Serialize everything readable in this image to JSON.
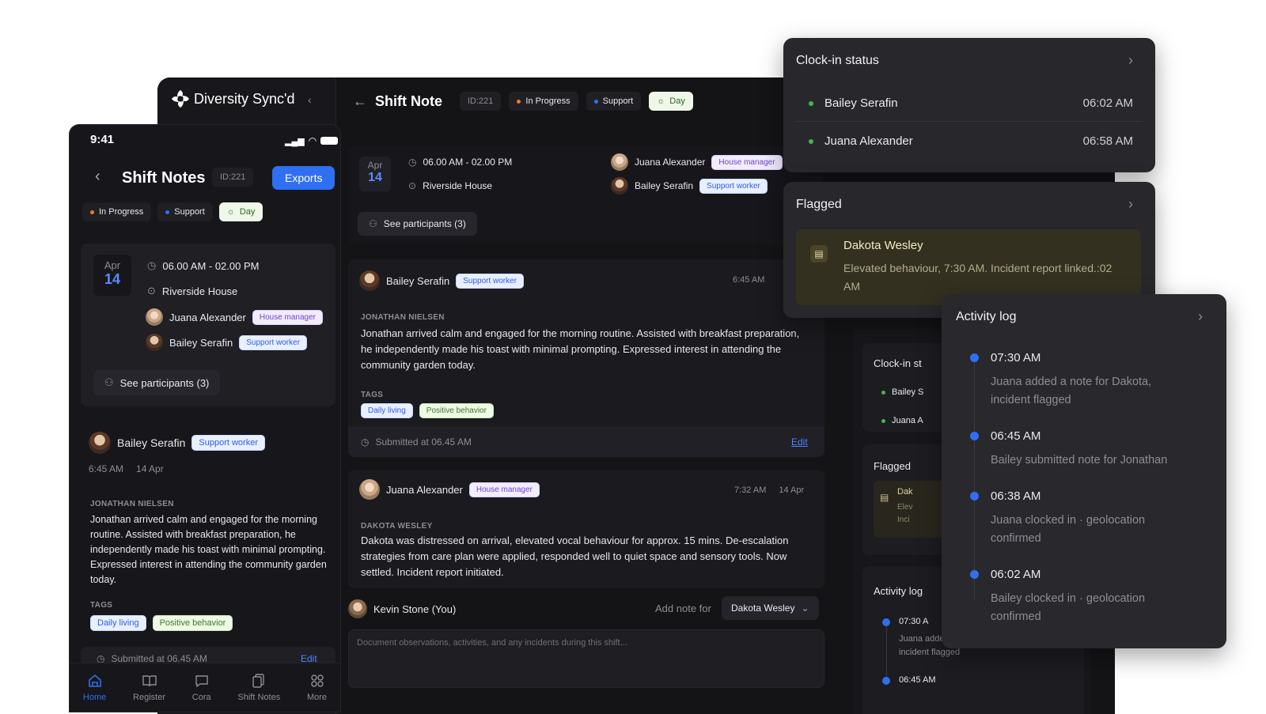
{
  "desktop": {
    "brand": "Diversity Sync'd",
    "header": {
      "title": "Shift Note",
      "id": "ID:221",
      "status": "In Progress",
      "type": "Support",
      "shift": "Day"
    },
    "summary": {
      "month": "Apr",
      "day": "14",
      "time": "06.00 AM - 02.00 PM",
      "location": "Riverside House",
      "people": [
        {
          "name": "Juana Alexander",
          "role": "House manager"
        },
        {
          "name": "Bailey Serafin",
          "role": "Support worker"
        }
      ],
      "participants_btn": "See participants (3)"
    },
    "notes": [
      {
        "author": "Bailey Serafin",
        "role": "Support worker",
        "time": "6:45 AM",
        "subject": "JONATHAN NIELSEN",
        "body": "Jonathan arrived calm and engaged for the morning routine. Assisted with breakfast preparation, he independently made his toast with minimal prompting. Expressed interest in attending the community garden today.",
        "tags_label": "TAGS",
        "tags": [
          "Daily living",
          "Positive behavior"
        ],
        "submitted": "Submitted at 06.45 AM",
        "edit": "Edit"
      },
      {
        "author": "Juana Alexander",
        "role": "House manager",
        "time": "7:32 AM",
        "date": "14 Apr",
        "subject": "DAKOTA WESLEY",
        "body": "Dakota was distressed on arrival, elevated vocal behaviour for approx. 15 mins. De-escalation strategies from care plan were applied, responded well to quiet space and sensory tools. Now settled. Incident report initiated."
      }
    ],
    "composer": {
      "user": "Kevin Stone (You)",
      "add_note_for": "Add note for",
      "selected": "Dakota Wesley",
      "placeholder": "Document observations, activities, and any incidents during this shift..."
    },
    "right_panel": {
      "clock_title": "Clock-in st",
      "clock_names": [
        "Bailey S",
        "Juana A"
      ],
      "flagged_title": "Flagged",
      "flag_lines": [
        "Dak",
        "Elev",
        "Inci"
      ],
      "activity_title": "Activity log",
      "act": [
        {
          "time": "07:30 A",
          "text": "Juana added a note for Dakota, incident flagged"
        },
        {
          "time": "06:45 AM"
        }
      ]
    }
  },
  "phone": {
    "status_time": "9:41",
    "title": "Shift Notes",
    "id": "ID:221",
    "exports": "Exports",
    "status": "In Progress",
    "type": "Support",
    "shift": "Day",
    "month": "Apr",
    "day": "14",
    "time": "06.00 AM - 02.00 PM",
    "location": "Riverside House",
    "people": [
      {
        "name": "Juana Alexander",
        "role": "House manager"
      },
      {
        "name": "Bailey Serafin",
        "role": "Support worker"
      }
    ],
    "participants_btn": "See participants (3)",
    "note": {
      "author": "Bailey Serafin",
      "role": "Support worker",
      "time": "6:45 AM",
      "date": "14 Apr",
      "subject": "JONATHAN NIELSEN",
      "body": "Jonathan arrived calm and engaged for the morning routine. Assisted with breakfast preparation, he independently made his toast with minimal prompting. Expressed interest in attending the community garden today.",
      "tags_label": "TAGS",
      "tags": [
        "Daily living",
        "Positive behavior"
      ],
      "submitted": "Submitted at 06.45 AM",
      "edit": "Edit"
    },
    "nav": [
      "Home",
      "Register",
      "Cora",
      "Shift Notes",
      "More"
    ]
  },
  "clockin": {
    "title": "Clock-in status",
    "rows": [
      {
        "name": "Bailey Serafin",
        "time": "06:02 AM"
      },
      {
        "name": "Juana Alexander",
        "time": "06:58 AM"
      }
    ]
  },
  "flagged": {
    "title": "Flagged",
    "name": "Dakota Wesley",
    "text": "Elevated behaviour, 7:30 AM. Incident report linked.:02 AM"
  },
  "activity": {
    "title": "Activity log",
    "items": [
      {
        "time": "07:30 AM",
        "text": "Juana added a note for Dakota, incident flagged"
      },
      {
        "time": "06:45 AM",
        "text": "Bailey submitted note for Jonathan"
      },
      {
        "time": "06:38 AM",
        "text": "Juana clocked in · geolocation confirmed"
      },
      {
        "time": "06:02 AM",
        "text": "Bailey clocked in · geolocation confirmed"
      }
    ]
  },
  "colors": {
    "accent": "#2f6ff1",
    "status_dot": "#f07a2a",
    "online": "#3fb950"
  }
}
